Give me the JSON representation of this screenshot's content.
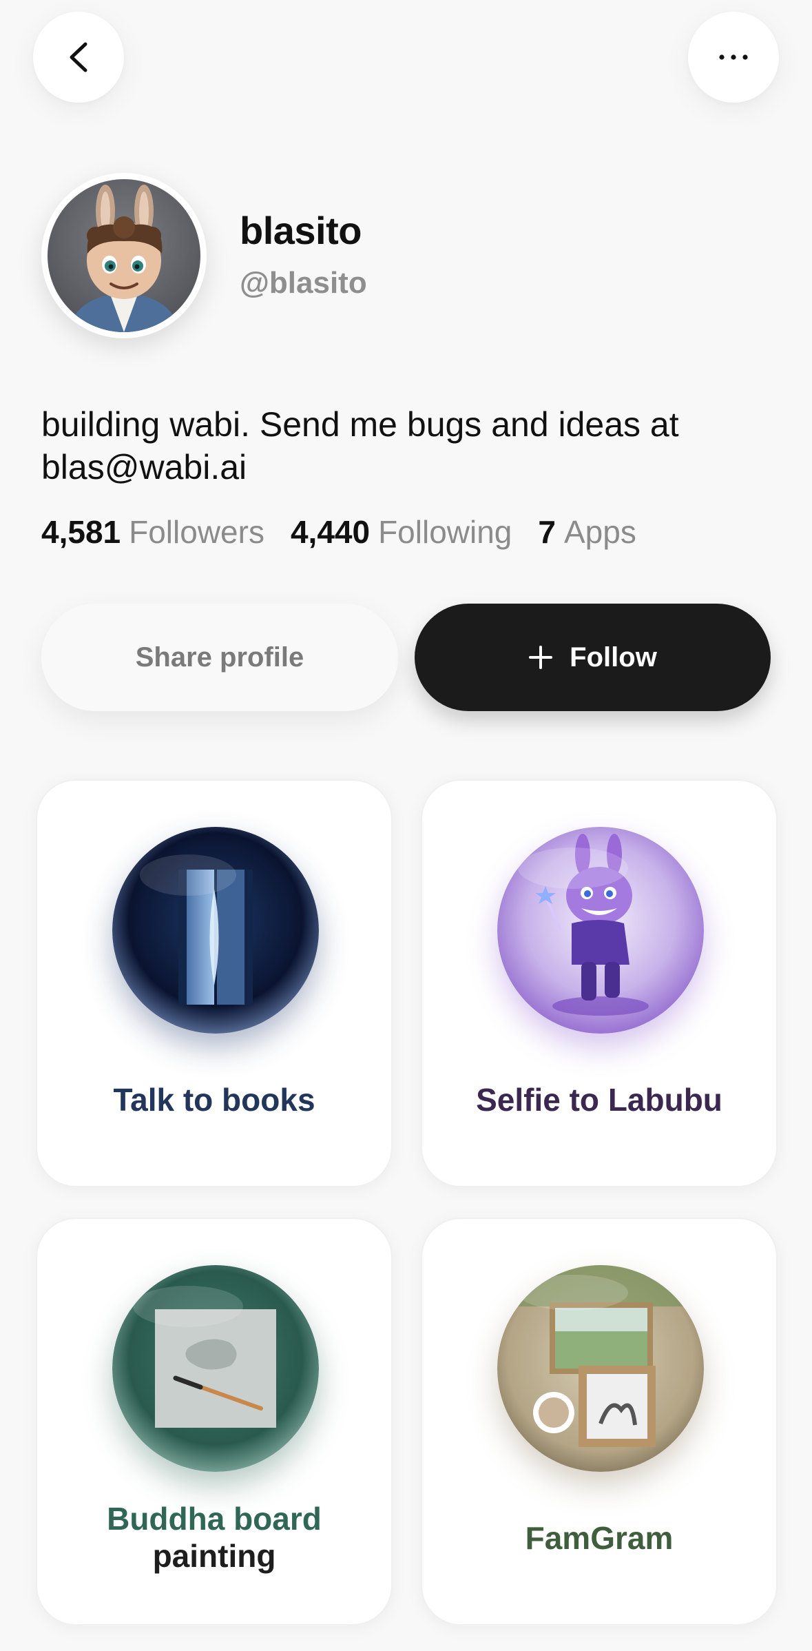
{
  "nav": {
    "back_icon": "chevron-left-icon",
    "more_icon": "more-horizontal-icon"
  },
  "profile": {
    "display_name": "blasito",
    "handle": "@blasito",
    "bio": "building wabi. Send me bugs and ideas at blas@wabi.ai"
  },
  "stats": {
    "followers_count": "4,581",
    "followers_label": "Followers",
    "following_count": "4,440",
    "following_label": "Following",
    "apps_count": "7",
    "apps_label": "Apps"
  },
  "actions": {
    "share_label": "Share profile",
    "follow_label": "Follow",
    "follow_icon": "plus-icon"
  },
  "apps": [
    {
      "title": "Talk to books",
      "color": "#22355a"
    },
    {
      "title": "Selfie to Labubu",
      "color": "#3a2850"
    },
    {
      "title_line1": "Buddha board",
      "title_line2": "painting",
      "color_line1": "#2f6656",
      "color_line2": "#1e1e1e"
    },
    {
      "title": "FamGram",
      "color": "#3f5e3c"
    }
  ]
}
